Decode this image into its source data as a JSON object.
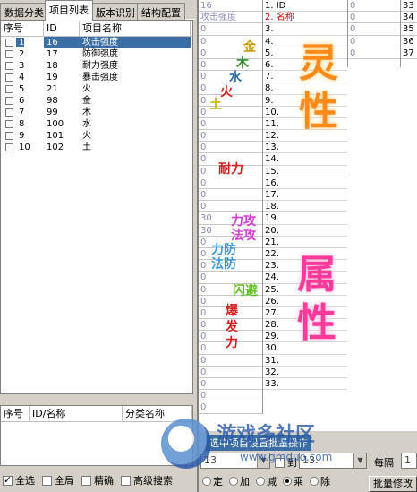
{
  "tabs": [
    "数据分类",
    "项目列表",
    "版本识别",
    "结构配置"
  ],
  "active_tab_index": 1,
  "list": {
    "columns": [
      "序号",
      "ID",
      "项目名称"
    ],
    "rows": [
      {
        "num": "1",
        "id": "16",
        "name": "攻击强度",
        "selected": true
      },
      {
        "num": "2",
        "id": "17",
        "name": "防御强度"
      },
      {
        "num": "3",
        "id": "18",
        "name": "耐力强度"
      },
      {
        "num": "4",
        "id": "19",
        "name": "暴击强度"
      },
      {
        "num": "5",
        "id": "21",
        "name": "火"
      },
      {
        "num": "6",
        "id": "98",
        "name": "金"
      },
      {
        "num": "7",
        "id": "99",
        "name": "木"
      },
      {
        "num": "8",
        "id": "100",
        "name": "水"
      },
      {
        "num": "9",
        "id": "101",
        "name": "火"
      },
      {
        "num": "10",
        "id": "102",
        "name": "土"
      }
    ]
  },
  "list2": {
    "columns": [
      "序号",
      "ID/名称",
      "分类名称"
    ]
  },
  "bottom_checks": [
    {
      "label": "全选",
      "checked": true
    },
    {
      "label": "全局",
      "checked": false
    },
    {
      "label": "精确",
      "checked": false
    },
    {
      "label": "高级搜索",
      "checked": false
    }
  ],
  "grid": {
    "colA": [
      "16",
      "攻击强度",
      "0",
      "0",
      "0",
      "0",
      "0",
      "0",
      "0",
      "0",
      "0",
      "0",
      "0",
      "0",
      "0",
      "0",
      "0",
      "0",
      "30",
      "30",
      "0",
      "0",
      "0",
      "0",
      "0",
      "0",
      "0",
      "0",
      "0",
      "0",
      "0",
      "0",
      "0",
      "0",
      "0"
    ],
    "colB": [
      "1. ID",
      "2. 名称",
      "3.",
      "4.",
      "5.",
      "6.",
      "7.",
      "8.",
      "9.",
      "10.",
      "11.",
      "12.",
      "13.",
      "14.",
      "15.",
      "16.",
      "17.",
      "18.",
      "19.",
      "20.",
      "21.",
      "22.",
      "23.",
      "24.",
      "25.",
      "26.",
      "27.",
      "28.",
      "29.",
      "30.",
      "31.",
      "32.",
      "33."
    ],
    "colC": [
      "0",
      "0",
      "0",
      "0",
      "0"
    ],
    "colD": [
      "33",
      "34",
      "35",
      "36",
      "37"
    ]
  },
  "art": {
    "big1": "灵",
    "big2": "性",
    "big3": "属",
    "big4": "性",
    "gold": "金",
    "wood": "木",
    "water": "水",
    "fire": "火",
    "earth": "土",
    "stamina": "耐力",
    "attack1": "力攻",
    "attack2": "法攻",
    "def1": "力防",
    "def2": "法防",
    "dodge": "闪避",
    "crit1": "爆",
    "crit2": "发",
    "crit3": "力"
  },
  "controls": {
    "banner": "选中项目设置批量操作",
    "combo1": "13",
    "to_label": "到",
    "combo2": "13.",
    "interval_label": "每隔",
    "interval_value": "1",
    "radios": [
      {
        "label": "定",
        "on": false
      },
      {
        "label": "加",
        "on": false
      },
      {
        "label": "减",
        "on": false
      },
      {
        "label": "乘",
        "on": true
      },
      {
        "label": "除",
        "on": false
      }
    ],
    "batch_button": "批量修改"
  },
  "watermark": {
    "title": "游戏多社区",
    "url": "www.gmduo.com"
  },
  "colors": {
    "accent": "#3a6ea5",
    "gold": "#c89a00",
    "wood": "#2d8a2d",
    "water": "#2a6aa8",
    "fire": "#d42020",
    "earth": "#c8b000"
  }
}
